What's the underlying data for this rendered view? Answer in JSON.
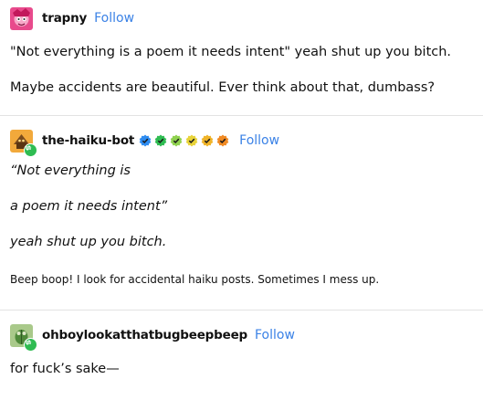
{
  "posts": [
    {
      "username": "trapny",
      "follow_label": "Follow",
      "avatar_icon": "pink-character-avatar",
      "paragraphs": [
        "\"Not everything is a poem it needs intent\" yeah shut up you bitch.",
        "Maybe accidents are beautiful. Ever think about that, dumbass?"
      ]
    },
    {
      "username": "the-haiku-bot",
      "follow_label": "Follow",
      "avatar_icon": "robot-avatar",
      "badge_icons": [
        "blue-check-badge",
        "green-check-badge",
        "lime-check-badge",
        "yellow-check-badge",
        "gold-check-badge",
        "orange-check-badge"
      ],
      "badge_colors": [
        "#2f8cf0",
        "#2fbc52",
        "#8fd14f",
        "#e8d33a",
        "#f0b429",
        "#f08a24"
      ],
      "paragraphs": [
        "“Not everything is",
        "a poem it needs intent”",
        "yeah shut up you bitch."
      ],
      "footnote": "Beep boop! I look for accidental haiku posts. Sometimes I mess up."
    },
    {
      "username": "ohboylookatthatbugbeepbeep",
      "follow_label": "Follow",
      "avatar_icon": "green-bug-avatar",
      "paragraphs": [
        "for fuck’s sake—"
      ]
    }
  ],
  "colors": {
    "follow": "#3b82e6",
    "reblog_badge": "#2fbc52",
    "divider": "#e3e3e3"
  }
}
